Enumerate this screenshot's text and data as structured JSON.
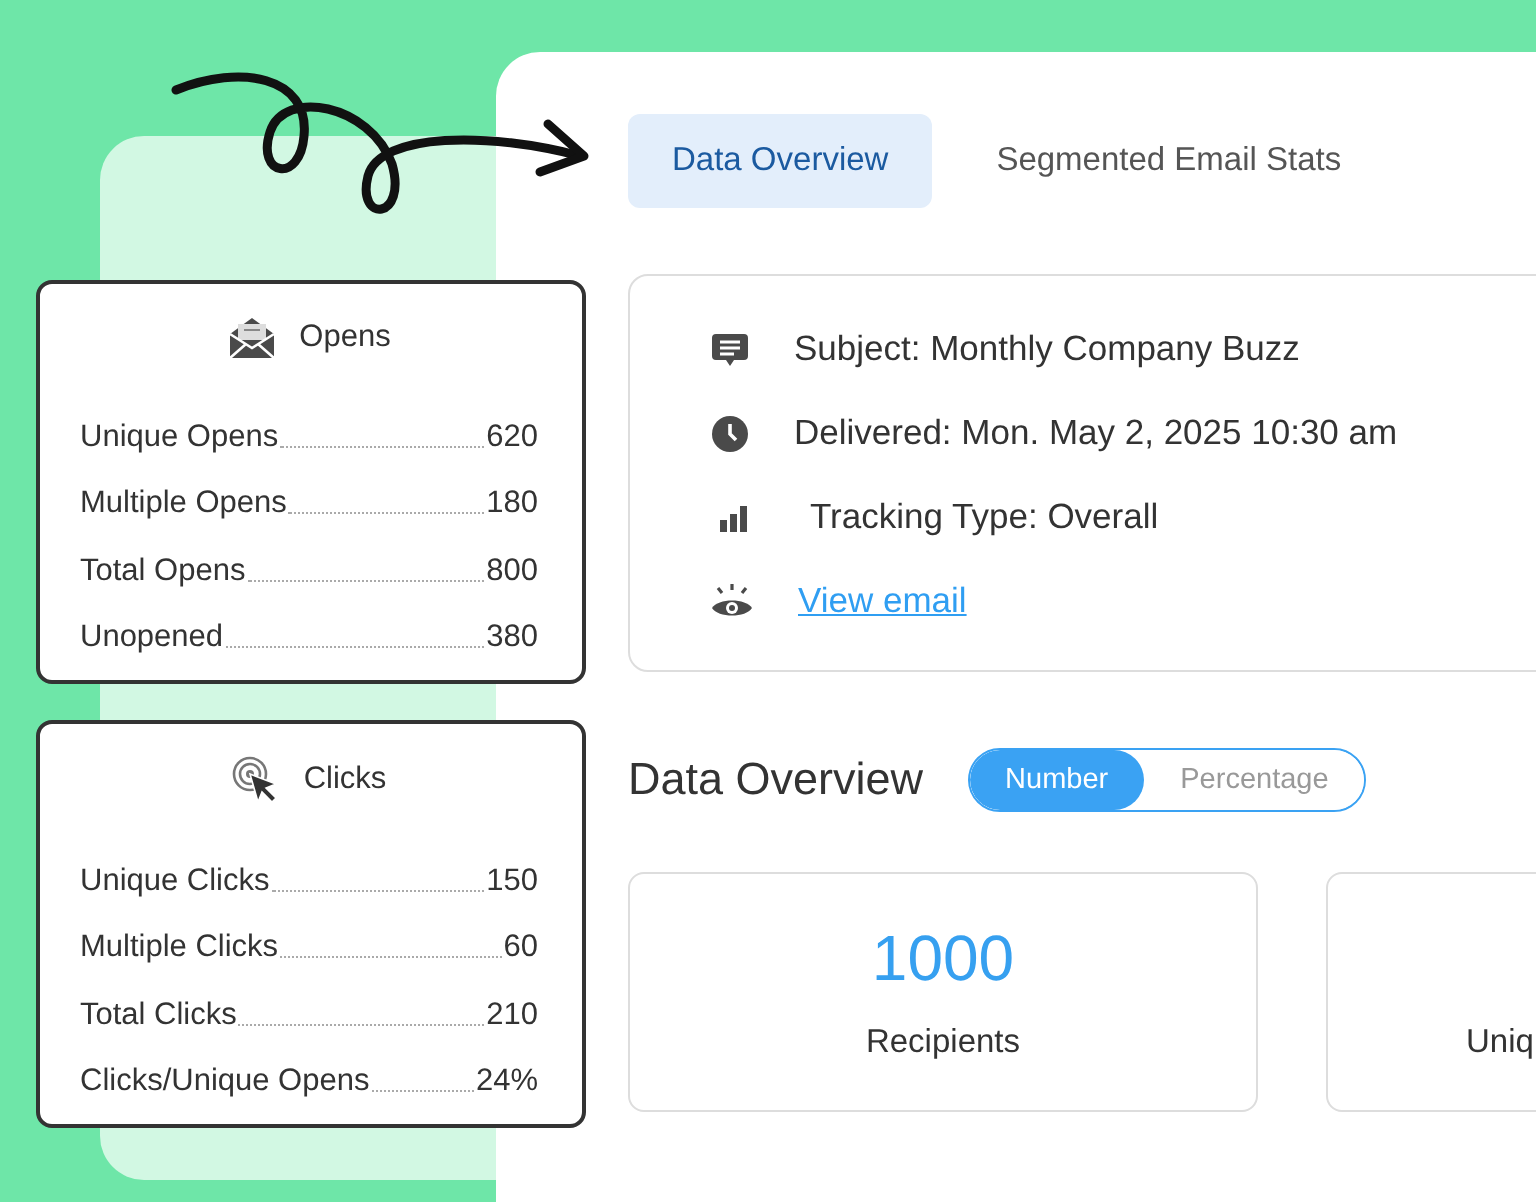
{
  "tabs": [
    {
      "label": "Data Overview",
      "selected": true
    },
    {
      "label": "Segmented Email Stats",
      "selected": false
    }
  ],
  "summary_cards": [
    {
      "title": "Opens",
      "kind": "opens",
      "rows": [
        {
          "label": "Unique Opens",
          "value": "620"
        },
        {
          "label": "Multiple Opens",
          "value": "180"
        },
        {
          "label": "Total Opens",
          "value": "800"
        },
        {
          "label": "Unopened",
          "value": "380"
        }
      ]
    },
    {
      "title": "Clicks",
      "kind": "clicks",
      "rows": [
        {
          "label": "Unique Clicks",
          "value": "150"
        },
        {
          "label": "Multiple Clicks",
          "value": "60"
        },
        {
          "label": "Total Clicks",
          "value": "210"
        },
        {
          "label": "Clicks/Unique Opens",
          "value": "24%"
        }
      ]
    }
  ],
  "email_info": [
    {
      "kind": "subject",
      "label": "Subject:",
      "value": "Monthly Company Buzz"
    },
    {
      "kind": "delivered",
      "label": "Delivered:",
      "value": "Mon. May 2, 2025 10:30 am"
    },
    {
      "kind": "tracking",
      "label": "Tracking Type:",
      "value": "Overall"
    },
    {
      "kind": "link",
      "value": "View email"
    }
  ],
  "section_title": "Data Overview",
  "toggle": [
    {
      "label": "Number",
      "selected": true
    },
    {
      "label": "Percentage",
      "selected": false
    }
  ],
  "stats": [
    {
      "value": "1000",
      "label": "Recipients"
    },
    {
      "label": "Uniq"
    }
  ]
}
